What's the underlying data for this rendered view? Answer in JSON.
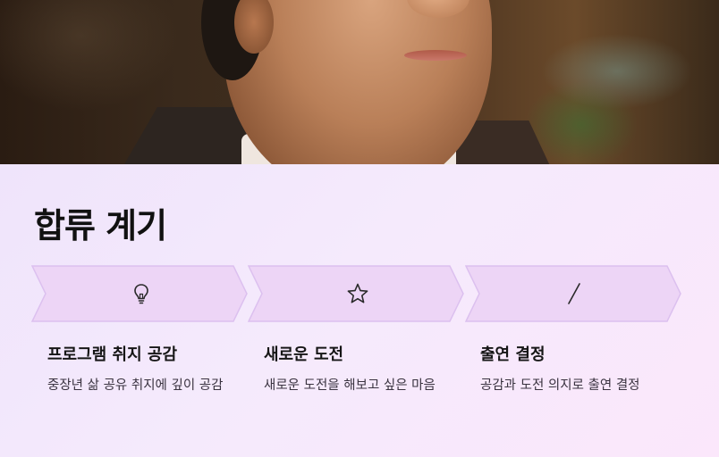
{
  "section": {
    "title": "합류 계기"
  },
  "steps": [
    {
      "icon": "lightbulb-icon",
      "title": "프로그램 취지 공감",
      "description": "중장년 삶 공유 취지에 깊이 공감"
    },
    {
      "icon": "star-icon",
      "title": "새로운 도전",
      "description": "새로운 도전을 해보고 싶은 마음"
    },
    {
      "icon": "slash-icon",
      "title": "출연 결정",
      "description": "공감과 도전 의지로 출연 결정"
    }
  ],
  "colors": {
    "chevron_fill": "#edd5f6",
    "chevron_stroke": "#dcc0ef",
    "background": "#f4ecfb"
  }
}
